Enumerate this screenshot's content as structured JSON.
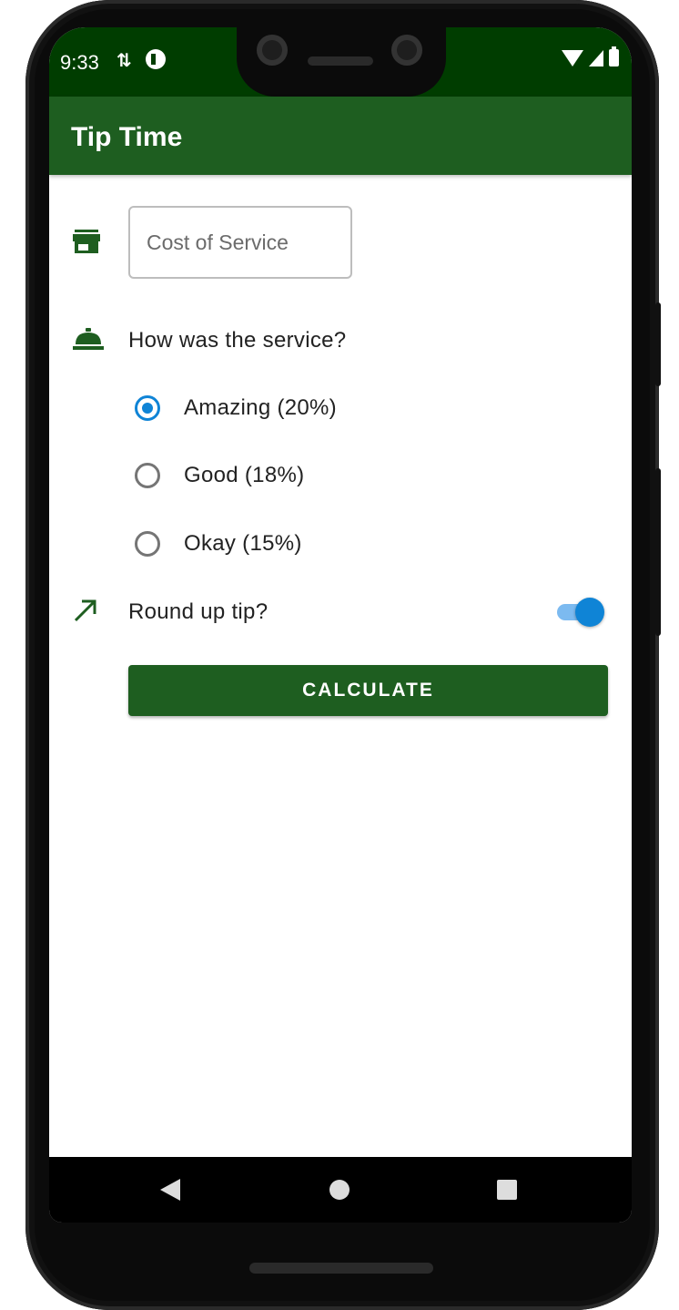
{
  "status_bar": {
    "time": "9:33",
    "sync_glyph": "⇅"
  },
  "app_bar": {
    "title": "Tip Time"
  },
  "cost_field": {
    "placeholder": "Cost of Service",
    "value": ""
  },
  "service_question": "How was the service?",
  "tip_options": [
    {
      "label": "Amazing (20%)",
      "checked": true
    },
    {
      "label": "Good (18%)",
      "checked": false
    },
    {
      "label": "Okay (15%)",
      "checked": false
    }
  ],
  "round_up": {
    "label": "Round up tip?",
    "on": true
  },
  "calculate_button": "CALCULATE",
  "colors": {
    "primary": "#1e5e20",
    "status_bar": "#003d00",
    "accent": "#0f84d6"
  },
  "icons": [
    "store-icon",
    "room-service-icon",
    "trending-up-icon",
    "wifi-icon",
    "cell-signal-icon",
    "battery-icon",
    "back-icon",
    "home-icon",
    "recents-icon"
  ]
}
